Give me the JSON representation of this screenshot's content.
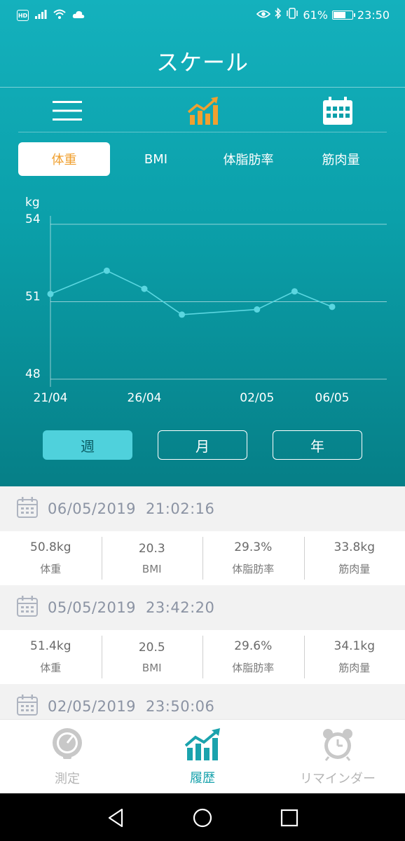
{
  "status_bar": {
    "hd": "HD",
    "battery_percent": "61%",
    "battery_level": 0.61,
    "time": "23:50",
    "icons": [
      "signal-icon",
      "wifi-icon",
      "cloud-icon",
      "eye-icon",
      "bluetooth-icon",
      "vibrate-icon",
      "battery-icon"
    ]
  },
  "app": {
    "title": "スケール"
  },
  "toolbar": {
    "icons": [
      "menu-icon",
      "chart-icon",
      "calendar-icon"
    ]
  },
  "metric_tabs": [
    {
      "label": "体重",
      "active": true
    },
    {
      "label": "BMI",
      "active": false
    },
    {
      "label": "体脂肪率",
      "active": false
    },
    {
      "label": "筋肉量",
      "active": false
    }
  ],
  "chart_data": {
    "type": "line",
    "ylabel": "kg",
    "yticks": [
      54,
      51,
      48
    ],
    "ylim": [
      48,
      54
    ],
    "xlim": [
      "21/04",
      "06/05"
    ],
    "xtick_labels": [
      "21/04",
      "26/04",
      "02/05",
      "06/05"
    ],
    "series": [
      {
        "points": [
          {
            "x": "21/04",
            "y": 51.3
          },
          {
            "x": "24/04",
            "y": 52.2
          },
          {
            "x": "26/04",
            "y": 51.5
          },
          {
            "x": "28/04",
            "y": 50.5
          },
          {
            "x": "02/05",
            "y": 50.7
          },
          {
            "x": "04/05",
            "y": 51.4
          },
          {
            "x": "06/05",
            "y": 50.8
          }
        ]
      }
    ],
    "line_color": "#5ad6e0",
    "grid": true
  },
  "range_tabs": [
    {
      "label": "週",
      "active": true
    },
    {
      "label": "月",
      "active": false
    },
    {
      "label": "年",
      "active": false
    }
  ],
  "records": [
    {
      "date": "06/05/2019",
      "time": "21:02:16",
      "stats": [
        {
          "value": "50.8kg",
          "label": "体重"
        },
        {
          "value": "20.3",
          "label": "BMI"
        },
        {
          "value": "29.3%",
          "label": "体脂肪率"
        },
        {
          "value": "33.8kg",
          "label": "筋肉量"
        }
      ]
    },
    {
      "date": "05/05/2019",
      "time": "23:42:20",
      "stats": [
        {
          "value": "51.4kg",
          "label": "体重"
        },
        {
          "value": "20.5",
          "label": "BMI"
        },
        {
          "value": "29.6%",
          "label": "体脂肪率"
        },
        {
          "value": "34.1kg",
          "label": "筋肉量"
        }
      ]
    },
    {
      "date": "02/05/2019",
      "time": "23:50:06",
      "stats": []
    }
  ],
  "bottom_nav": [
    {
      "label": "測定",
      "icon": "gauge-icon",
      "active": false
    },
    {
      "label": "履歴",
      "icon": "chart-icon",
      "active": true
    },
    {
      "label": "リマインダー",
      "icon": "alarm-clock-icon",
      "active": false
    }
  ],
  "colors": {
    "header_top": "#14b1bd",
    "header_bottom": "#067f87",
    "accent_orange": "#f0a030",
    "active_teal": "#1aa3ad"
  }
}
